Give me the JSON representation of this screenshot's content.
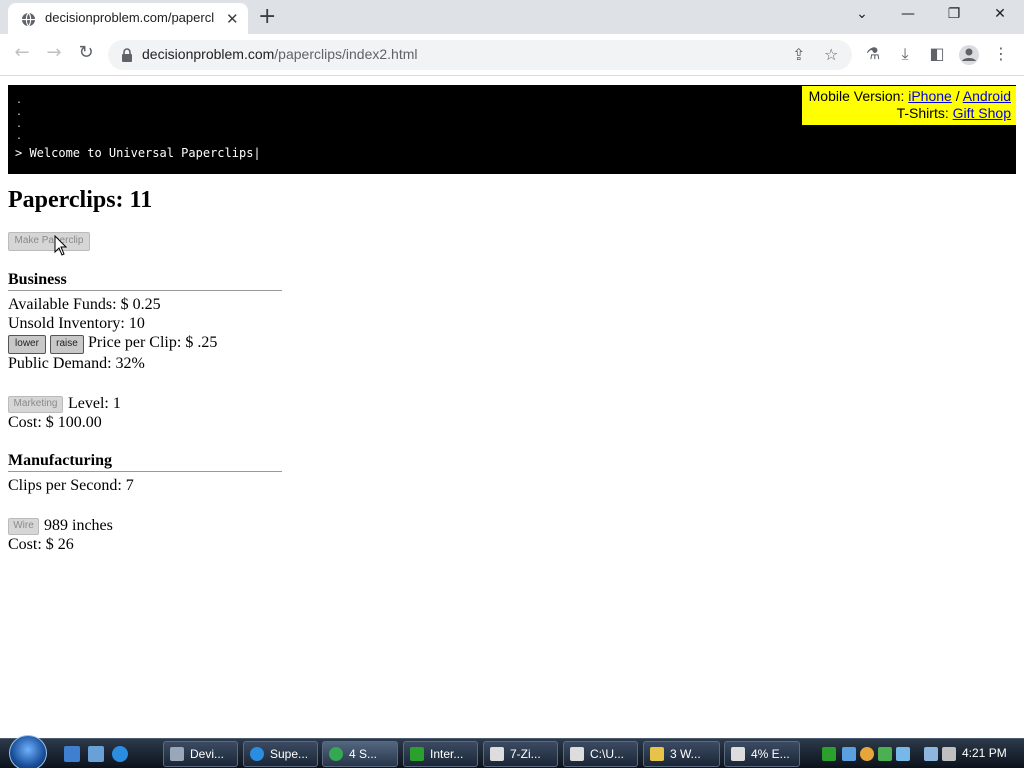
{
  "browser": {
    "tab_title": "decisionproblem.com/paperclip",
    "url_host": "decisionproblem.com",
    "url_path": "/paperclips/index2.html"
  },
  "console": {
    "prompt_line": "> Welcome to Universal Paperclips|"
  },
  "promo": {
    "mobile_label": "Mobile Version:",
    "iphone": "iPhone",
    "separator": "/",
    "android": "Android",
    "tshirts_label": "T-Shirts:",
    "gift_shop": "Gift Shop"
  },
  "game": {
    "paperclips_label": "Paperclips: 11",
    "make_paperclip_button": "Make Paperclip",
    "business": {
      "title": "Business",
      "available_funds": "Available Funds: $ 0.25",
      "unsold_inventory": "Unsold Inventory: 10",
      "lower_button": "lower",
      "raise_button": "raise",
      "price_per_clip": "Price per Clip: $ .25",
      "public_demand": "Public Demand: 32%",
      "marketing_button": "Marketing",
      "marketing_level": "Level: 1",
      "marketing_cost": "Cost: $ 100.00"
    },
    "manufacturing": {
      "title": "Manufacturing",
      "clips_per_second": "Clips per Second: 7",
      "wire_button": "Wire",
      "wire_amount": "989 inches",
      "wire_cost": "Cost: $ 26"
    }
  },
  "taskbar": {
    "tasks": [
      "Devi...",
      "Supe...",
      "4 S...",
      "Inter...",
      "7-Zi...",
      "C:\\U...",
      "3 W...",
      "4% E..."
    ],
    "clock": "4:21 PM"
  },
  "colors": {
    "promo_bg": "#ffff00",
    "console_bg": "#000000",
    "link": "#0000ee"
  },
  "icons": [
    "globe-icon",
    "lock-icon",
    "share-icon",
    "star-icon",
    "extension-icon",
    "download-icon",
    "sidepanel-icon",
    "profile-icon",
    "menu-icon",
    "mouse-cursor-icon",
    "windows-start-icon"
  ]
}
